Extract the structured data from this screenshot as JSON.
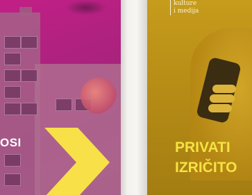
{
  "left_cover": {
    "title_fragment": "OSI",
    "colors": {
      "background": "#b8217f",
      "chevron": "#f7e048",
      "title": "#ffffff"
    }
  },
  "right_cover": {
    "publisher_lines": [
      "kulture",
      "i medija"
    ],
    "title_lines": [
      "PRIVATI",
      "IZRIČITO"
    ],
    "colors": {
      "background": "#c0951a",
      "title": "#f5e342",
      "publisher": "#fbf3d8"
    }
  }
}
